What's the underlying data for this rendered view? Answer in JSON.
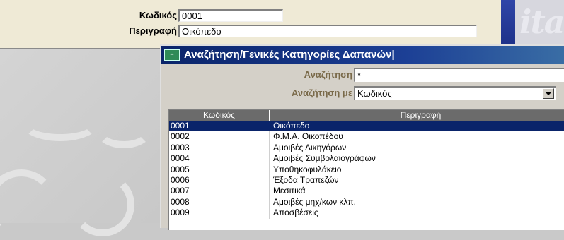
{
  "form": {
    "code_label": "Κωδικός",
    "code_value": "0001",
    "description_label": "Περιγραφή",
    "description_value": "Οικόπεδο"
  },
  "dialog": {
    "title": "Αναζήτηση/Γενικές Κατηγορίες Δαπανών|",
    "search_label": "Αναζήτηση",
    "search_value": "*",
    "search_by_label": "Αναζήτηση με",
    "search_by_value": "Κωδικός",
    "grid": {
      "columns": [
        "Κωδικός",
        "Περιγραφή"
      ],
      "rows": [
        {
          "code": "0001",
          "description": "Οικόπεδο"
        },
        {
          "code": "0002",
          "description": "Φ.Μ.Α.  Οικοπέδου"
        },
        {
          "code": "0003",
          "description": "Αμοιβές Δικηγόρων"
        },
        {
          "code": "0004",
          "description": "Αμοιβές Συμβολαιογράφων"
        },
        {
          "code": "0005",
          "description": "Υποθηκοφυλάκειο"
        },
        {
          "code": "0006",
          "description": "Έξοδα Τραπεζών"
        },
        {
          "code": "0007",
          "description": "Μεσιτικά"
        },
        {
          "code": "0008",
          "description": "Αμοιβές μηχ/κων κλπ."
        },
        {
          "code": "0009",
          "description": "Αποσβέσεις"
        }
      ],
      "selected_index": 0
    }
  },
  "colors": {
    "selection": "#0a246a",
    "title_bar": "#0a246a",
    "header_bg": "#6b6b6b",
    "panel_bg": "#efead6"
  }
}
